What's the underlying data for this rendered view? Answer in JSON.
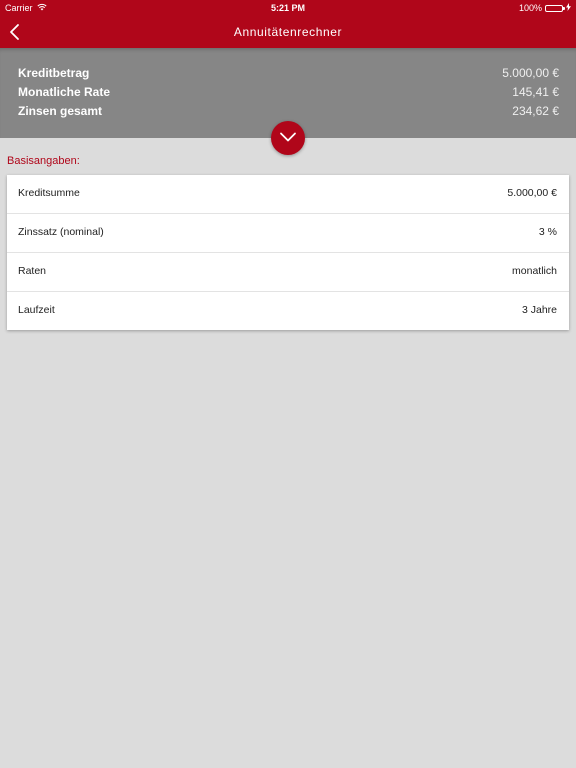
{
  "status_bar": {
    "carrier": "Carrier",
    "time": "5:21 PM",
    "battery": "100%"
  },
  "navbar": {
    "title": "Annuitätenrechner"
  },
  "summary": {
    "rows": [
      {
        "label": "Kreditbetrag",
        "value": "5.000,00 €"
      },
      {
        "label": "Monatliche Rate",
        "value": "145,41 €"
      },
      {
        "label": "Zinsen gesamt",
        "value": "234,62 €"
      }
    ]
  },
  "section": {
    "title": "Basisangaben:"
  },
  "inputs": [
    {
      "label": "Kreditsumme",
      "value": "5.000,00 €"
    },
    {
      "label": "Zinssatz (nominal)",
      "value": "3 %"
    },
    {
      "label": "Raten",
      "value": "monatlich"
    },
    {
      "label": "Laufzeit",
      "value": "3 Jahre"
    }
  ],
  "colors": {
    "accent": "#b0061a",
    "summary_bg": "#868686",
    "page_bg": "#dcdcdc"
  }
}
